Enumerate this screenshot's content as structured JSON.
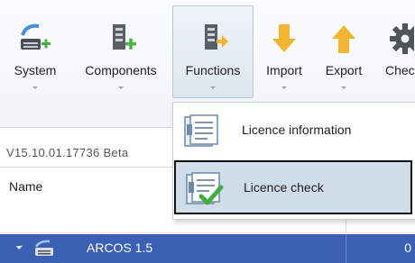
{
  "ribbon": {
    "buttons": [
      {
        "name": "system",
        "label": "System",
        "icon": "add-system-icon"
      },
      {
        "name": "components",
        "label": "Components",
        "icon": "add-component-icon"
      },
      {
        "name": "functions",
        "label": "Functions",
        "icon": "functions-icon",
        "active": true
      },
      {
        "name": "import",
        "label": "Import",
        "icon": "import-arrow-icon"
      },
      {
        "name": "export",
        "label": "Export",
        "icon": "export-arrow-icon"
      },
      {
        "name": "check",
        "label": "Chec",
        "icon": "gear-icon"
      }
    ]
  },
  "dropdown": {
    "items": [
      {
        "label": "Licence information",
        "icon": "licence-document-icon"
      },
      {
        "label": "Licence check",
        "icon": "licence-check-icon",
        "highlighted": true
      }
    ]
  },
  "status": {
    "version": "V15.10.01.17736 Beta"
  },
  "grid": {
    "columns": {
      "name": "Name"
    },
    "rows": [
      {
        "name": "ARCOS 1.5",
        "value": "0",
        "icon": "system-icon"
      }
    ]
  },
  "colors": {
    "accent_selection": "#3b5fb2",
    "menu_highlight": "#cfdcea",
    "import_export": "#f2b531",
    "add_green": "#44b544"
  }
}
